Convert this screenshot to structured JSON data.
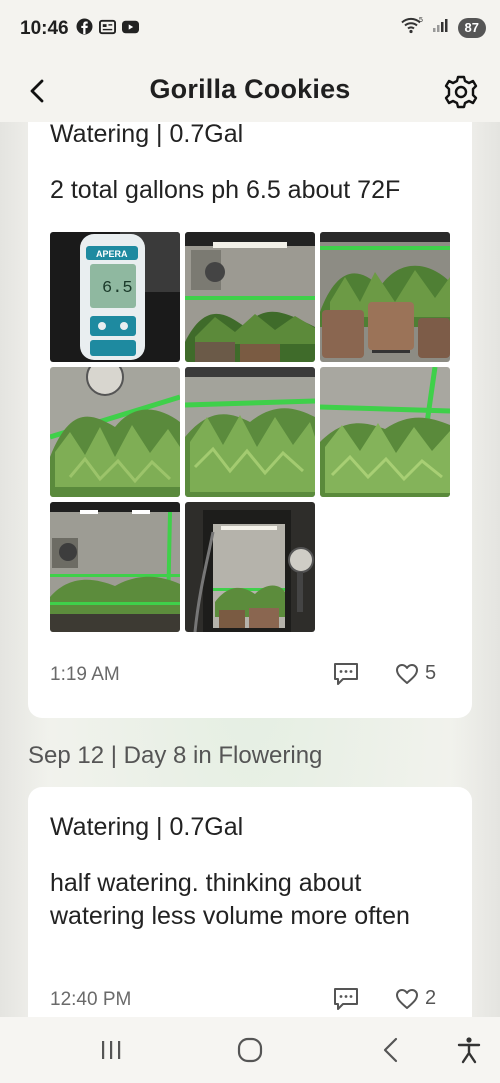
{
  "status_bar": {
    "time": "10:46",
    "battery": "87",
    "left_icons": [
      "facebook-icon",
      "news-icon",
      "youtube-icon"
    ],
    "right_icons": [
      "wifi-icon",
      "signal-icon",
      "battery-icon"
    ]
  },
  "header": {
    "title": "Gorilla Cookies",
    "back_icon": "chevron-left-icon",
    "settings_icon": "gear-icon"
  },
  "entries": [
    {
      "title": "Watering | 0.7Gal",
      "body": "2 total gallons ph 6.5 about 72F",
      "photos": [
        "ph-meter-photo",
        "grow-tent-photo",
        "fabric-pots-photo",
        "canopy-photo",
        "canopy-photo",
        "canopy-photo",
        "tent-top-photo",
        "tent-open-photo"
      ],
      "time": "1:19 AM",
      "likes": "5"
    },
    {
      "day_header": "Sep 12 | Day 8 in Flowering",
      "title": "Watering | 0.7Gal",
      "body": "half watering. thinking about watering less volume more often",
      "time": "12:40 PM",
      "likes": "2"
    }
  ],
  "meter_reading": "6.5",
  "meter_brand": "APERA",
  "nav": [
    "recent-apps-button",
    "home-button",
    "back-button",
    "accessibility-button"
  ]
}
